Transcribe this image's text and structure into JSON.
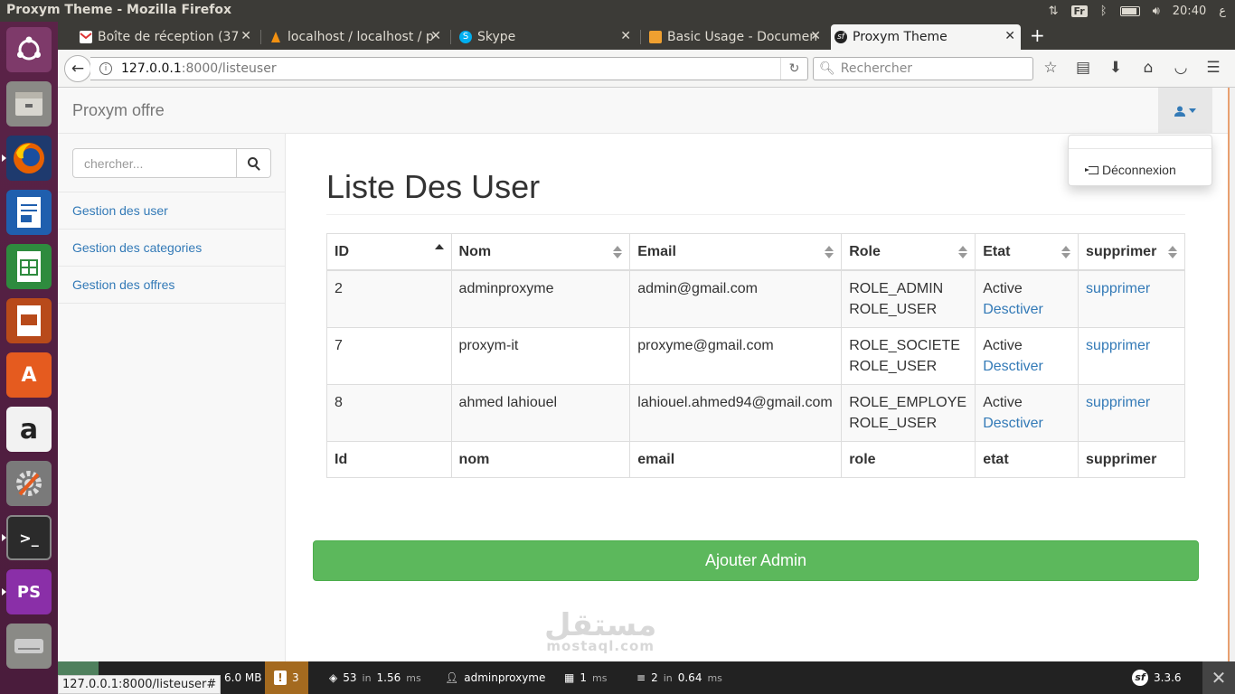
{
  "os": {
    "window_title": "Proxym Theme - Mozilla Firefox",
    "keyboard": "Fr",
    "time": "20:40",
    "locale_glyph": "ع"
  },
  "browser": {
    "tabs": [
      {
        "label": "Boîte de réception (37",
        "icon": "gmail-icon"
      },
      {
        "label": "localhost / localhost / p",
        "icon": "phpmyadmin-icon"
      },
      {
        "label": "Skype",
        "icon": "skype-icon"
      },
      {
        "label": "Basic Usage - Documen",
        "icon": "docs-icon"
      },
      {
        "label": "Proxym Theme",
        "icon": "symfony-icon"
      }
    ],
    "url_host": "127.0.0.1",
    "url_path": ":8000/listeuser",
    "search_placeholder": "Rechercher",
    "status_url": "127.0.0.1:8000/listeuser#"
  },
  "app": {
    "brand": "Proxym offre",
    "logout_label": "Déconnexion",
    "search_placeholder": "chercher...",
    "menu": [
      {
        "label": "Gestion des user"
      },
      {
        "label": "Gestion des categories"
      },
      {
        "label": "Gestion des offres"
      }
    ],
    "page_title": "Liste Des User",
    "table": {
      "headers": [
        "ID",
        "Nom",
        "Email",
        "Role",
        "Etat",
        "supprimer"
      ],
      "footer": [
        "Id",
        "nom",
        "email",
        "role",
        "etat",
        "supprimer"
      ],
      "rows": [
        {
          "id": "2",
          "nom": "adminproxyme",
          "email": "admin@gmail.com",
          "role1": "ROLE_ADMIN",
          "role2": "ROLE_USER",
          "etat": "Active",
          "action": "Desctiver",
          "delete": "supprimer"
        },
        {
          "id": "7",
          "nom": "proxym-it",
          "email": "proxyme@gmail.com",
          "role1": "ROLE_SOCIETE",
          "role2": "ROLE_USER",
          "etat": "Active",
          "action": "Desctiver",
          "delete": "supprimer"
        },
        {
          "id": "8",
          "nom": "ahmed lahiouel",
          "email": "lahiouel.ahmed94@gmail.com",
          "role1": "ROLE_EMPLOYE",
          "role2": "ROLE_USER",
          "etat": "Active",
          "action": "Desctiver",
          "delete": "supprimer"
        }
      ]
    },
    "add_button": "Ajouter Admin"
  },
  "watermark": {
    "arabic": "مستقل",
    "latin": "mostaql.com"
  },
  "profiler": {
    "memory": "6.0 MB",
    "warnings": "3",
    "requests": "53",
    "requests_time": "1.56",
    "user": "adminproxyme",
    "time_value": "1",
    "db_queries": "2",
    "db_time": "0.64",
    "version": "3.3.6",
    "in_label": "in",
    "ms_label": "ms"
  },
  "colors": {
    "accent_link": "#337ab7",
    "success": "#5cb85c",
    "launcher": "#5b2348",
    "os_bar": "#3c3b37"
  }
}
